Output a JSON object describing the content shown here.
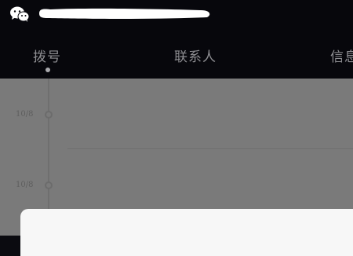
{
  "app": {
    "icon": "wechat-icon",
    "title_redacted": true
  },
  "tabs": [
    {
      "label": "拨号",
      "active": true
    },
    {
      "label": "联系人",
      "active": false
    },
    {
      "label": "信息",
      "active": false
    }
  ],
  "call_log": {
    "entries": [
      {
        "date": "10/8"
      },
      {
        "date": "10/8"
      }
    ]
  },
  "colors": {
    "header_bg": "#07070c",
    "tab_text": "#8e8e92",
    "content_overlay": "#7a7a7a",
    "sheet_bg": "#f7f7f7"
  }
}
